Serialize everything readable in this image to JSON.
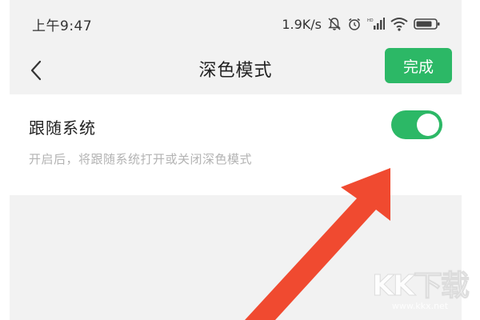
{
  "status_bar": {
    "time": "上午9:47",
    "net_speed": "1.9K/s",
    "icons": [
      "bell-off-icon",
      "alarm-icon",
      "hd-signal-icon",
      "wifi-icon",
      "battery-icon"
    ]
  },
  "navbar": {
    "title": "深色模式",
    "done_label": "完成",
    "accent": "#2cb866"
  },
  "setting": {
    "title": "跟随系统",
    "description": "开启后，将跟随系统打开或关闭深色模式",
    "toggle_on": true
  },
  "annotation": {
    "arrow_color": "#f04a30"
  },
  "watermark": {
    "logo": "KK下载",
    "url": "www.kkx.net"
  }
}
